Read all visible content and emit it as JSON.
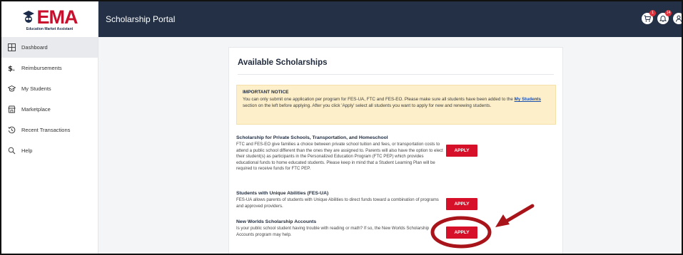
{
  "app": {
    "logo_text": "EMA",
    "logo_subtitle": "Education Market Assistant",
    "title": "Scholarship Portal"
  },
  "topbar": {
    "icons": [
      {
        "name": "cart-icon",
        "badge": "1"
      },
      {
        "name": "bell-icon",
        "badge": "14"
      },
      {
        "name": "user-icon",
        "badge": ""
      }
    ]
  },
  "sidebar": {
    "items": [
      {
        "label": "Dashboard",
        "icon": "dashboard-icon",
        "active": true
      },
      {
        "label": "Reimbursements",
        "icon": "dollar-icon"
      },
      {
        "label": "My Students",
        "icon": "graduation-cap-icon"
      },
      {
        "label": "Marketplace",
        "icon": "store-icon"
      },
      {
        "label": "Recent Transactions",
        "icon": "history-icon"
      },
      {
        "label": "Help",
        "icon": "search-icon"
      }
    ]
  },
  "main": {
    "card_title": "Available Scholarships",
    "notice": {
      "heading": "IMPORTANT NOTICE",
      "text_before": "You can only submit one application per program for FES-UA, FTC and FES-EO. Please make sure all students have been added to the ",
      "link": "My Students",
      "text_after": " section on the left before applying. After you click 'Apply' select all students you want to apply for new and renewing students."
    },
    "scholarships": [
      {
        "title": "Scholarship for Private Schools, Transportation, and Homeschool",
        "description": "FTC and FES-EO give families a choice between private school tuition and fees, or transportation costs to attend a public school different than the ones they are assigned to. Parents will also have the option to elect their student(s) as participants in the Personalized Education Program (FTC PEP) which provides educational funds to home educated students. Please keep in mind that a Student Learning Plan will be required to receive funds for FTC PEP.",
        "apply_label": "APPLY"
      },
      {
        "title": "Students with Unique Abilities (FES-UA)",
        "description": "FES-UA allows parents of students with Unique Abilities to direct funds toward a combination of programs and approved providers.",
        "apply_label": "APPLY"
      },
      {
        "title": "New Worlds Scholarship Accounts",
        "description": "Is your public school student having trouble with reading or math? If so, the New Worlds Scholarship Accounts program may help.",
        "apply_label": "APPLY"
      }
    ]
  },
  "colors": {
    "topbar": "#233045",
    "apply_button": "#d7102a",
    "notice_bg": "#fcefc9",
    "annotation": "#a8141a"
  }
}
